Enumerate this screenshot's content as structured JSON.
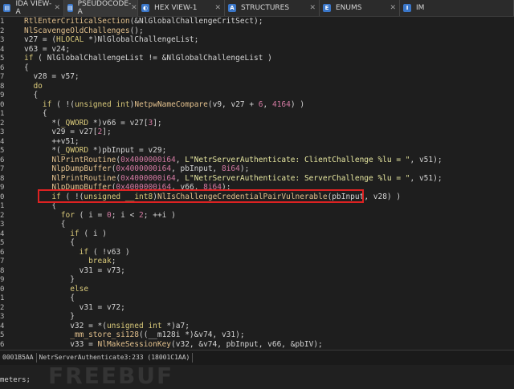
{
  "tabs": [
    {
      "label": "IDA VIEW-A",
      "icon": "ida-view-icon",
      "active": false
    },
    {
      "label": "PSEUDOCODE-A",
      "icon": "pseudocode-icon",
      "active": true
    },
    {
      "label": "HEX VIEW-1",
      "icon": "hex-view-icon",
      "active": false
    },
    {
      "label": "STRUCTURES",
      "icon": "structures-icon",
      "active": false
    },
    {
      "label": "ENUMS",
      "icon": "enums-icon",
      "active": false
    },
    {
      "label": "IM",
      "icon": "imports-icon",
      "active": false
    }
  ],
  "code_lines": [
    {
      "n": "1",
      "t": "RtlEnterCriticalSection(&NlGlobalChallengeCritSect);"
    },
    {
      "n": "2",
      "t": "NlScavengeOldChallenges();"
    },
    {
      "n": "3",
      "t": "v27 = (HLOCAL *)NlGlobalChallengeList;"
    },
    {
      "n": "4",
      "t": "v63 = v24;"
    },
    {
      "n": "5",
      "t": "if ( NlGlobalChallengeList != &NlGlobalChallengeList )"
    },
    {
      "n": "6",
      "t": "{"
    },
    {
      "n": "7",
      "t": "  v28 = v57;"
    },
    {
      "n": "8",
      "t": "  do"
    },
    {
      "n": "9",
      "t": "  {"
    },
    {
      "n": "0",
      "t": "    if ( !(unsigned int)NetpwNameCompare(v9, v27 + 6, 4164) )"
    },
    {
      "n": "1",
      "t": "    {"
    },
    {
      "n": "2",
      "t": "      *(_QWORD *)v66 = v27[3];"
    },
    {
      "n": "3",
      "t": "      v29 = v27[2];"
    },
    {
      "n": "4",
      "t": "      ++v51;"
    },
    {
      "n": "5",
      "t": "      *(_QWORD *)pbInput = v29;"
    },
    {
      "n": "6",
      "t": "      NlPrintRoutine(0x4000000i64, L\"NetrServerAuthenticate: ClientChallenge %lu = \", v51);"
    },
    {
      "n": "7",
      "t": "      NlpDumpBuffer(0x4000000i64, pbInput, 8i64);"
    },
    {
      "n": "8",
      "t": "      NlPrintRoutine(0x4000000i64, L\"NetrServerAuthenticate: ServerChallenge %lu = \", v51);"
    },
    {
      "n": "9",
      "t": "      NlpDumpBuffer(0x4000000i64, v66, 8i64);"
    },
    {
      "n": "0",
      "t": "      if ( !(unsigned __int8)NlIsChallengeCredentialPairVulnerable(pbInput, v28) )"
    },
    {
      "n": "1",
      "t": "      {"
    },
    {
      "n": "2",
      "t": "        for ( i = 0; i < 2; ++i )"
    },
    {
      "n": "3",
      "t": "        {"
    },
    {
      "n": "4",
      "t": "          if ( i )"
    },
    {
      "n": "5",
      "t": "          {"
    },
    {
      "n": "6",
      "t": "            if ( !v63 )"
    },
    {
      "n": "7",
      "t": "              break;"
    },
    {
      "n": "8",
      "t": "            v31 = v73;"
    },
    {
      "n": "9",
      "t": "          }"
    },
    {
      "n": "0",
      "t": "          else"
    },
    {
      "n": "1",
      "t": "          {"
    },
    {
      "n": "2",
      "t": "            v31 = v72;"
    },
    {
      "n": "3",
      "t": "          }"
    },
    {
      "n": "4",
      "t": "          v32 = *(unsigned int *)a7;"
    },
    {
      "n": "5",
      "t": "          _mm_store_si128((__m128i *)&v74, v31);"
    },
    {
      "n": "6",
      "t": "          v33 = NlMakeSessionKey(v32, &v74, pbInput, v66, &pbIV);"
    }
  ],
  "status": {
    "address": "0001B5AA",
    "location": "NetrServerAuthenticate3:233 (18001C1AA)"
  },
  "output": {
    "line": "meters;"
  },
  "watermark": "FREEBUF",
  "colors": {
    "highlight_box": "#dd2222",
    "background": "#1e1e1e"
  }
}
